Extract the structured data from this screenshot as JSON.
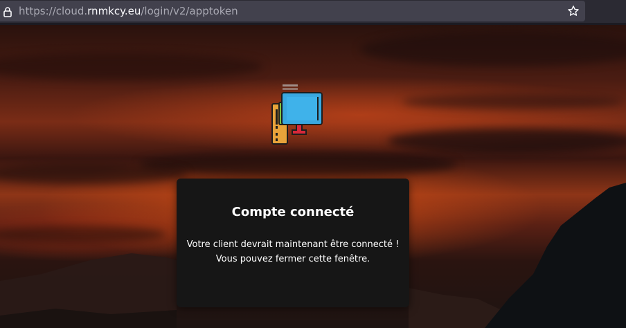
{
  "browser": {
    "url_prefix": "https://cloud.",
    "url_host": "rnmkcy.eu",
    "url_path": "/login/v2/apptoken",
    "icons": {
      "lock": "lock-icon",
      "bookmark": "star-icon"
    }
  },
  "card": {
    "title": "Compte connecté",
    "message_line1": "Votre client devrait maintenant être connecté !",
    "message_line2": "Vous pouvez fermer cette fenêtre."
  },
  "logo": {
    "icon": "client-device-logo-icon",
    "colors": {
      "tower": "#e8a33a",
      "monitor": "#3aa8e0",
      "stand": "#d8283a",
      "accent": "#7fc241"
    }
  }
}
